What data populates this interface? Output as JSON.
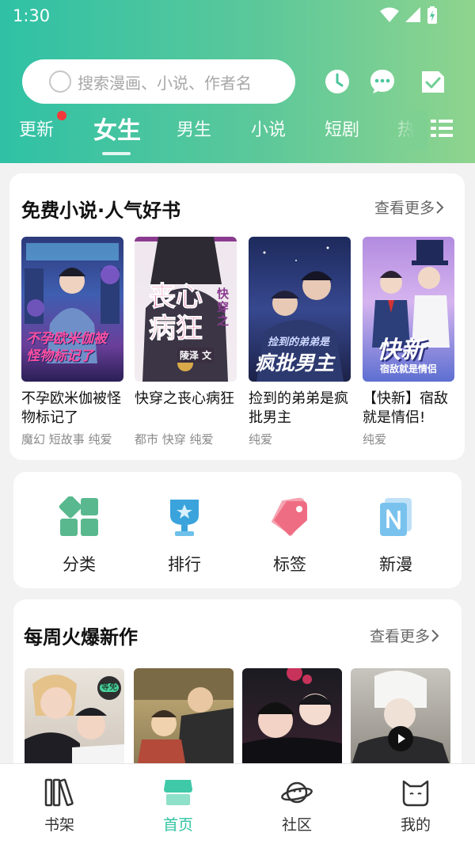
{
  "status": {
    "time": "1:30"
  },
  "search": {
    "placeholder": "搜索漫画、小说、作者名"
  },
  "tabs": [
    {
      "label": "更新"
    },
    {
      "label": "女生"
    },
    {
      "label": "男生"
    },
    {
      "label": "小说"
    },
    {
      "label": "短剧"
    },
    {
      "label": "热"
    }
  ],
  "free_novels": {
    "title": "免费小说·人气好书",
    "more": "查看更多",
    "books": [
      {
        "title": "不孕欧米伽被怪物标记了",
        "tags": "魔幻 短故事 纯爱",
        "cover_text": "不孕欧米伽被怪物标记了"
      },
      {
        "title": "快穿之丧心病狂",
        "tags": "都市 快穿 纯爱",
        "cover_text_main": "丧心病狂",
        "cover_text_side": "快穿之",
        "cover_author": "陵泽 文"
      },
      {
        "title": "捡到的弟弟是疯批男主",
        "tags": "纯爱",
        "cover_text_small": "捡到的弟弟是",
        "cover_text_main": "疯批男主"
      },
      {
        "title": "【快新】宿敌就是情侣!",
        "tags": "纯爱",
        "cover_text_main": "快新",
        "cover_text_small": "宿敌就是情侣"
      }
    ]
  },
  "quick_links": [
    {
      "label": "分类"
    },
    {
      "label": "排行"
    },
    {
      "label": "标签"
    },
    {
      "label": "新漫"
    }
  ],
  "weekly": {
    "title": "每周火爆新作",
    "more": "查看更多",
    "badge": "等免"
  },
  "bottom_nav": [
    {
      "label": "书架"
    },
    {
      "label": "首页"
    },
    {
      "label": "社区"
    },
    {
      "label": "我的"
    }
  ],
  "colors": {
    "accent": "#31c3a2",
    "header_left": "#2fc1a5",
    "header_right": "#8fd48e",
    "notification_dot": "#f23a3a"
  }
}
